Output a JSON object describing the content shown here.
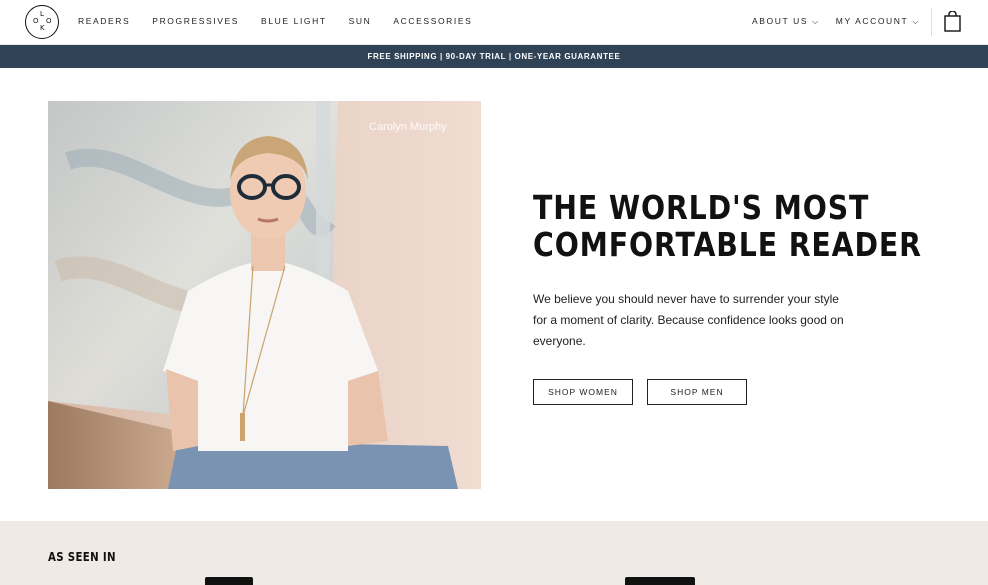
{
  "header": {
    "logo_letters": [
      "L",
      "O",
      "O",
      "K"
    ],
    "nav": [
      "READERS",
      "PROGRESSIVES",
      "BLUE LIGHT",
      "SUN",
      "ACCESSORIES"
    ],
    "right_nav": [
      {
        "label": "ABOUT US",
        "chevron": "⌵"
      },
      {
        "label": "MY ACCOUNT",
        "chevron": "⌵"
      }
    ]
  },
  "promo": {
    "text": "FREE SHIPPING | 90-DAY TRIAL | ONE-YEAR GUARANTEE"
  },
  "hero": {
    "caption": "Carolyn Murphy",
    "headline_line1": "THE WORLD'S MOST",
    "headline_line2": "COMFORTABLE READER",
    "body": "We believe you should never have to surrender your style for a moment of clarity. Because confidence looks good on everyone.",
    "buttons": {
      "women": "SHOP WOMEN",
      "men": "SHOP MEN"
    }
  },
  "press": {
    "title": "AS SEEN IN"
  },
  "colors": {
    "promo_bg": "#2f4256",
    "press_bg": "#efeae3"
  }
}
